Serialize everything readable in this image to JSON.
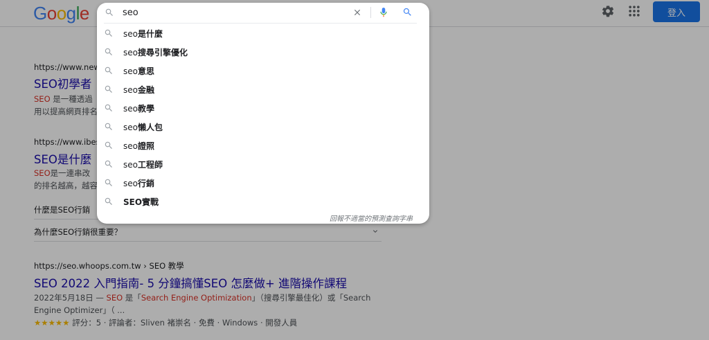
{
  "header": {
    "logo_letters": [
      {
        "ch": "G",
        "color": "#4285f4"
      },
      {
        "ch": "o",
        "color": "#ea4335"
      },
      {
        "ch": "o",
        "color": "#fbbc05"
      },
      {
        "ch": "g",
        "color": "#4285f4"
      },
      {
        "ch": "l",
        "color": "#34a853"
      },
      {
        "ch": "e",
        "color": "#ea4335"
      }
    ],
    "signin_label": "登入"
  },
  "search": {
    "query": "seo",
    "suggestions": [
      {
        "prefix": "seo",
        "suffix": "是什麼"
      },
      {
        "prefix": "seo",
        "suffix": "搜尋引擎優化"
      },
      {
        "prefix": "seo",
        "suffix": "意思"
      },
      {
        "prefix": "seo",
        "suffix": "金融"
      },
      {
        "prefix": "seo",
        "suffix": "教學"
      },
      {
        "prefix": "seo",
        "suffix": "懶人包"
      },
      {
        "prefix": "seo",
        "suffix": "證照"
      },
      {
        "prefix": "seo",
        "suffix": "工程師"
      },
      {
        "prefix": "seo",
        "suffix": "行銷"
      },
      {
        "prefix": "",
        "suffix": "SEO實戰"
      }
    ],
    "report_text": "回報不適當的預測查詢字串"
  },
  "results": {
    "r1": {
      "url": "https://www.news",
      "title": "SEO初學者",
      "snippet_em": "SEO",
      "snippet_line1": " 是一種透過",
      "snippet_line2": "用以提高網頁排名"
    },
    "r2": {
      "url": "https://www.ibest",
      "title": "SEO是什麼",
      "snippet_em": "SEO",
      "snippet_line1": "是一連串改",
      "snippet_line2": "的排名越高，越容"
    },
    "paa": {
      "q1": "什麼是SEO行銷",
      "q2": "為什麼SEO行銷很重要？"
    },
    "r3": {
      "url": "https://seo.whoops.com.tw › SEO 教學",
      "title": "SEO 2022 入門指南- 5 分鐘搞懂SEO 怎麼做+ 進階操作課程",
      "snippet_date": "2022年5月18日 — ",
      "snippet_em1": "SEO",
      "snippet_mid": " 是「",
      "snippet_em2": "Search Engine Optimization",
      "snippet_tail": "」（搜尋引擎最佳化）或「Search",
      "snippet_line2": "Engine Optimizer」（ ...",
      "stars": "★★★★★",
      "rating": " 評分：5 · 評論者：Sliven 褚崇名 · 免費 · Windows · 開發人員"
    }
  },
  "colors": {
    "accent": "#1a73e8",
    "link": "#1a0dab",
    "highlight": "#d93025"
  }
}
